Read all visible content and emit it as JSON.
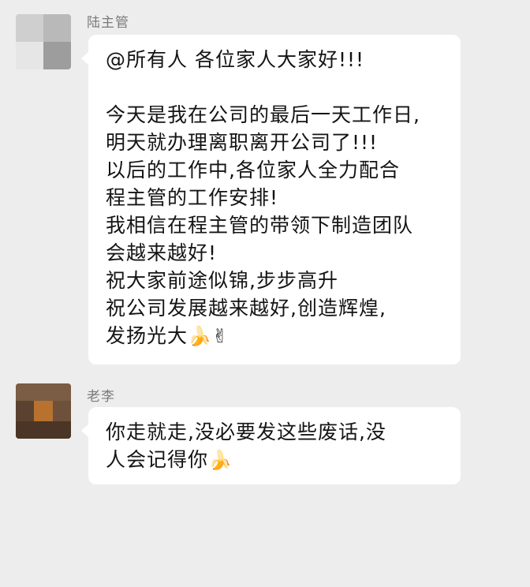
{
  "messages": [
    {
      "sender": "陆主管",
      "lines": [
        "@所有人 各位家人大家好!!!",
        "",
        "今天是我在公司的最后一天工作日,",
        "明天就办理离职离开公司了!!!",
        "以后的工作中,各位家人全力配合",
        "程主管的工作安排!",
        "我相信在程主管的带领下制造团队",
        "会越来越好!",
        "祝大家前途似锦,步步高升",
        "祝公司发展越来越好,创造辉煌,",
        "发扬光大"
      ],
      "emojis": [
        "🍌",
        "✌"
      ]
    },
    {
      "sender": "老李",
      "lines": [
        "你走就走,没必要发这些废话,没",
        "人会记得你"
      ],
      "emojis": [
        "🍌"
      ]
    }
  ]
}
